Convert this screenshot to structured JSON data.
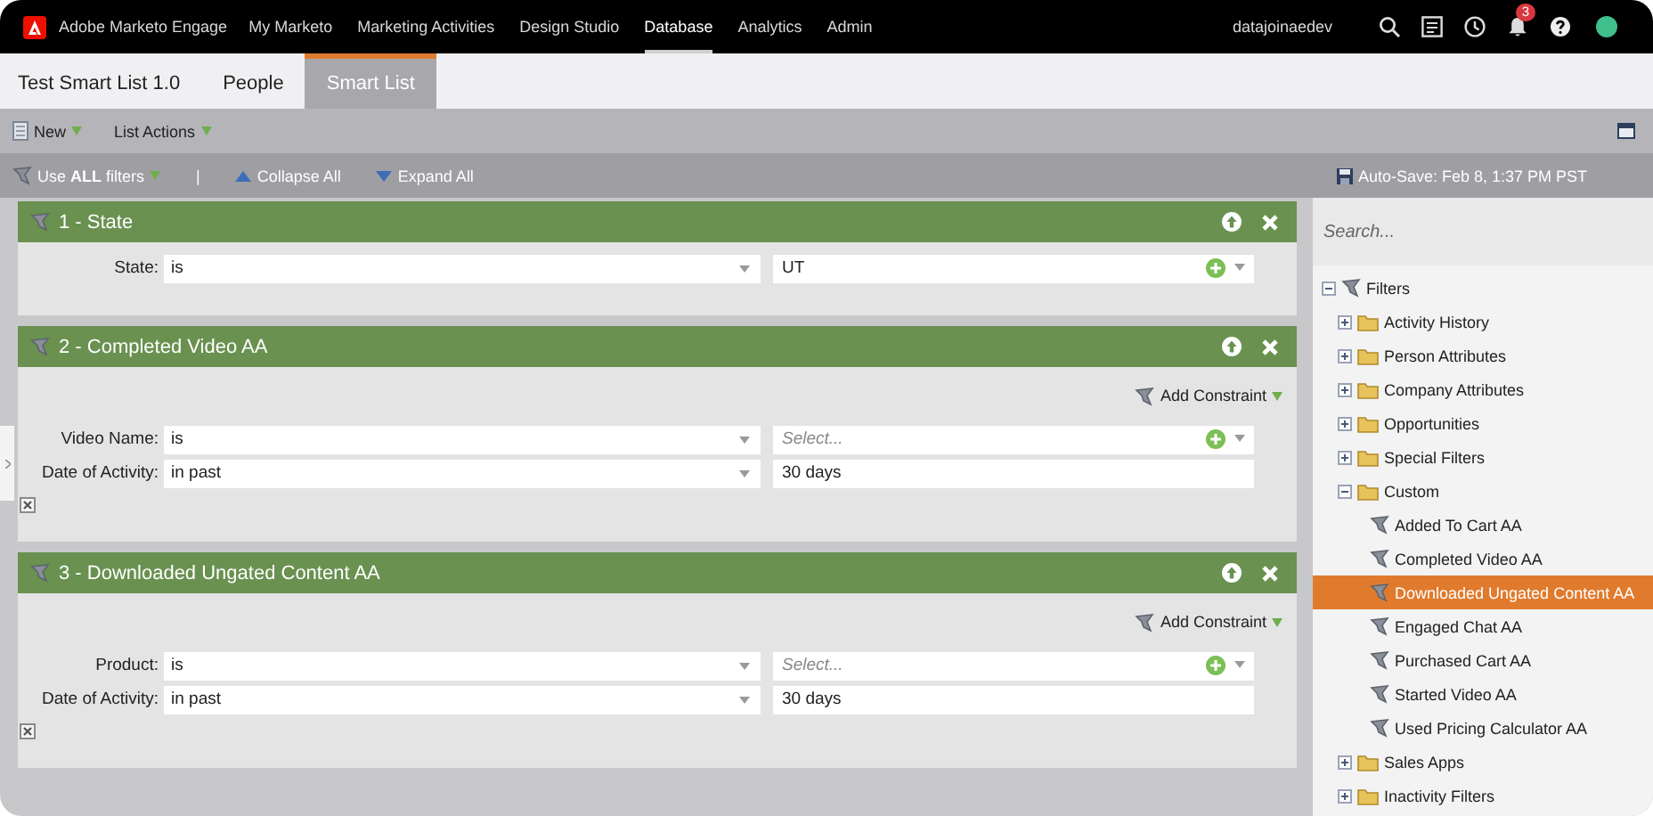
{
  "top_nav": {
    "brand": "Adobe Marketo Engage",
    "items": [
      {
        "label": "My Marketo",
        "selected": false
      },
      {
        "label": "Marketing Activities",
        "selected": false
      },
      {
        "label": "Design Studio",
        "selected": false
      },
      {
        "label": "Database",
        "selected": true
      },
      {
        "label": "Analytics",
        "selected": false
      },
      {
        "label": "Admin",
        "selected": false
      }
    ],
    "user": "datajoinaedev",
    "notification_count": "3"
  },
  "tabs": [
    {
      "label": "Test Smart List 1.0",
      "selected": false
    },
    {
      "label": "People",
      "selected": false
    },
    {
      "label": "Smart List",
      "selected": true
    }
  ],
  "toolbar": {
    "buttons": [
      "New",
      "List Actions"
    ]
  },
  "filter_bar": {
    "logic": "Use **ALL** filters",
    "separator": "|",
    "collapse": "Collapse All",
    "expand": "Expand All",
    "auto_save": "Auto-Save: Feb 8, 1:37 PM PST"
  },
  "filters": [
    {
      "title": "1 - State",
      "constraints_editable": false,
      "rows": [
        {
          "label": "State:",
          "operator": "is",
          "value": {
            "kind": "picklist",
            "value": "UT"
          }
        }
      ]
    },
    {
      "title": "2 - Completed Video AA",
      "constraints_editable": true,
      "add_constraint": "Add Constraint",
      "rows": [
        {
          "label": "Video Name:",
          "operator": "is",
          "value": {
            "kind": "picklist",
            "placeholder": "Select..."
          }
        },
        {
          "label": "Date of Activity:",
          "operator": "in past",
          "value": {
            "kind": "text",
            "value": "30 days"
          }
        }
      ]
    },
    {
      "title": "3 - Downloaded Ungated Content AA",
      "constraints_editable": true,
      "add_constraint": "Add Constraint",
      "rows": [
        {
          "label": "Product:",
          "operator": "is",
          "value": {
            "kind": "picklist",
            "placeholder": "Select..."
          }
        },
        {
          "label": "Date of Activity:",
          "operator": "in past",
          "value": {
            "kind": "text",
            "value": "30 days"
          }
        }
      ]
    }
  ],
  "sidebar": {
    "search": {
      "placeholder": "Search..."
    },
    "tree": [
      {
        "label": "Filters",
        "kind": "root",
        "expanded": true,
        "children": [
          {
            "label": "Activity History",
            "kind": "folder",
            "expanded": false
          },
          {
            "label": "Person Attributes",
            "kind": "folder",
            "expanded": false
          },
          {
            "label": "Company Attributes",
            "kind": "folder",
            "expanded": false
          },
          {
            "label": "Opportunities",
            "kind": "folder",
            "expanded": false
          },
          {
            "label": "Special Filters",
            "kind": "folder",
            "expanded": false
          },
          {
            "label": "Custom",
            "kind": "folder",
            "expanded": true,
            "children": [
              {
                "label": "Added To Cart AA",
                "kind": "filter",
                "selected": false
              },
              {
                "label": "Completed Video AA",
                "kind": "filter",
                "selected": false
              },
              {
                "label": "Downloaded Ungated Content AA",
                "kind": "filter",
                "selected": true
              },
              {
                "label": "Engaged Chat AA",
                "kind": "filter",
                "selected": false
              },
              {
                "label": "Purchased Cart AA",
                "kind": "filter",
                "selected": false
              },
              {
                "label": "Started Video AA",
                "kind": "filter",
                "selected": false
              },
              {
                "label": "Used Pricing Calculator AA",
                "kind": "filter",
                "selected": false
              }
            ]
          },
          {
            "label": "Sales Apps",
            "kind": "folder",
            "expanded": false
          },
          {
            "label": "Inactivity Filters",
            "kind": "folder",
            "expanded": false
          }
        ]
      }
    ]
  }
}
